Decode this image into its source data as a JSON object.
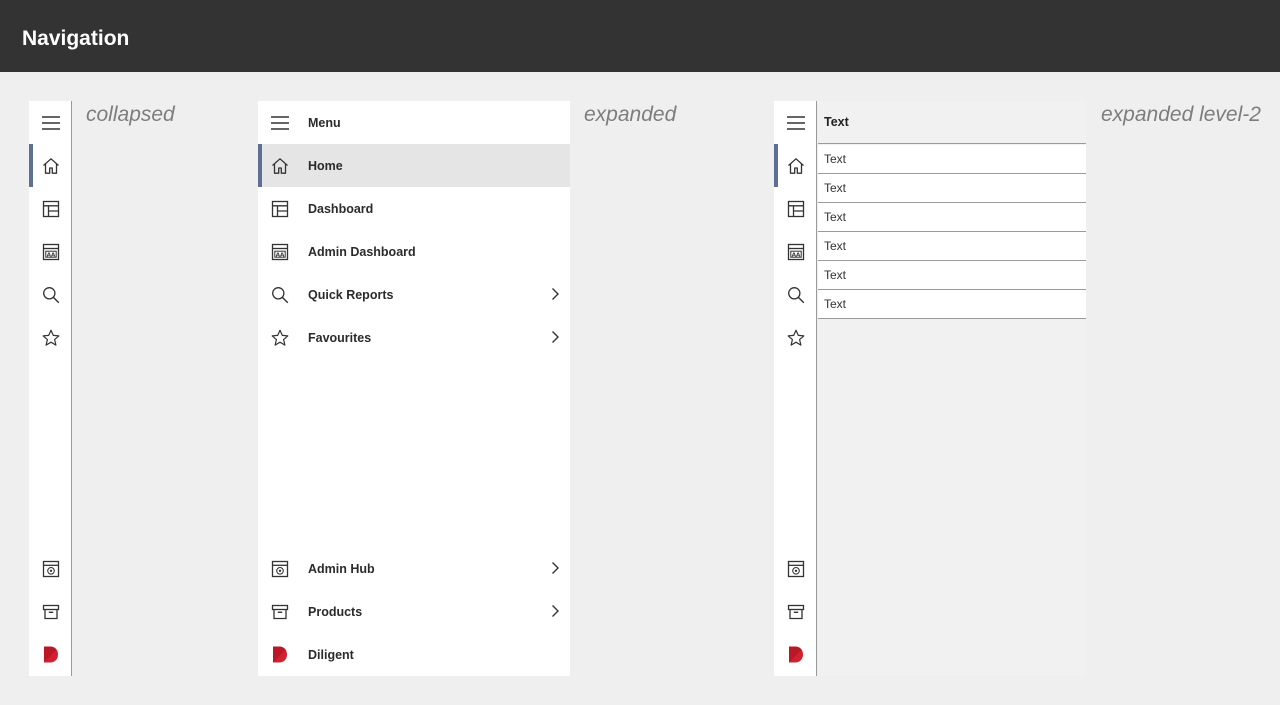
{
  "page": {
    "title": "Navigation"
  },
  "variants": {
    "collapsed": "collapsed",
    "expanded": "expanded",
    "expanded_level2": "expanded level-2"
  },
  "menu": {
    "header_label": "Menu",
    "top_items": [
      {
        "label": "Home",
        "icon": "home-icon",
        "active": true,
        "has_submenu": false
      },
      {
        "label": "Dashboard",
        "icon": "dashboard-icon",
        "active": false,
        "has_submenu": false
      },
      {
        "label": "Admin Dashboard",
        "icon": "admin-dashboard-icon",
        "active": false,
        "has_submenu": false
      },
      {
        "label": "Quick Reports",
        "icon": "search-icon",
        "active": false,
        "has_submenu": true
      },
      {
        "label": "Favourites",
        "icon": "star-icon",
        "active": false,
        "has_submenu": true
      }
    ],
    "bottom_items": [
      {
        "label": "Admin Hub",
        "icon": "admin-hub-icon",
        "has_submenu": true
      },
      {
        "label": "Products",
        "icon": "archive-box-icon",
        "has_submenu": true
      },
      {
        "label": "Diligent",
        "icon": "diligent-logo-icon",
        "has_submenu": false
      }
    ]
  },
  "submenu": {
    "header": "Text",
    "items": [
      "Text",
      "Text",
      "Text",
      "Text",
      "Text",
      "Text"
    ]
  },
  "colors": {
    "topbar": "#333333",
    "background": "#efefef",
    "active_accent": "#5e6f96",
    "active_row": "#e5e5e5",
    "brand_red": "#d1202f"
  }
}
